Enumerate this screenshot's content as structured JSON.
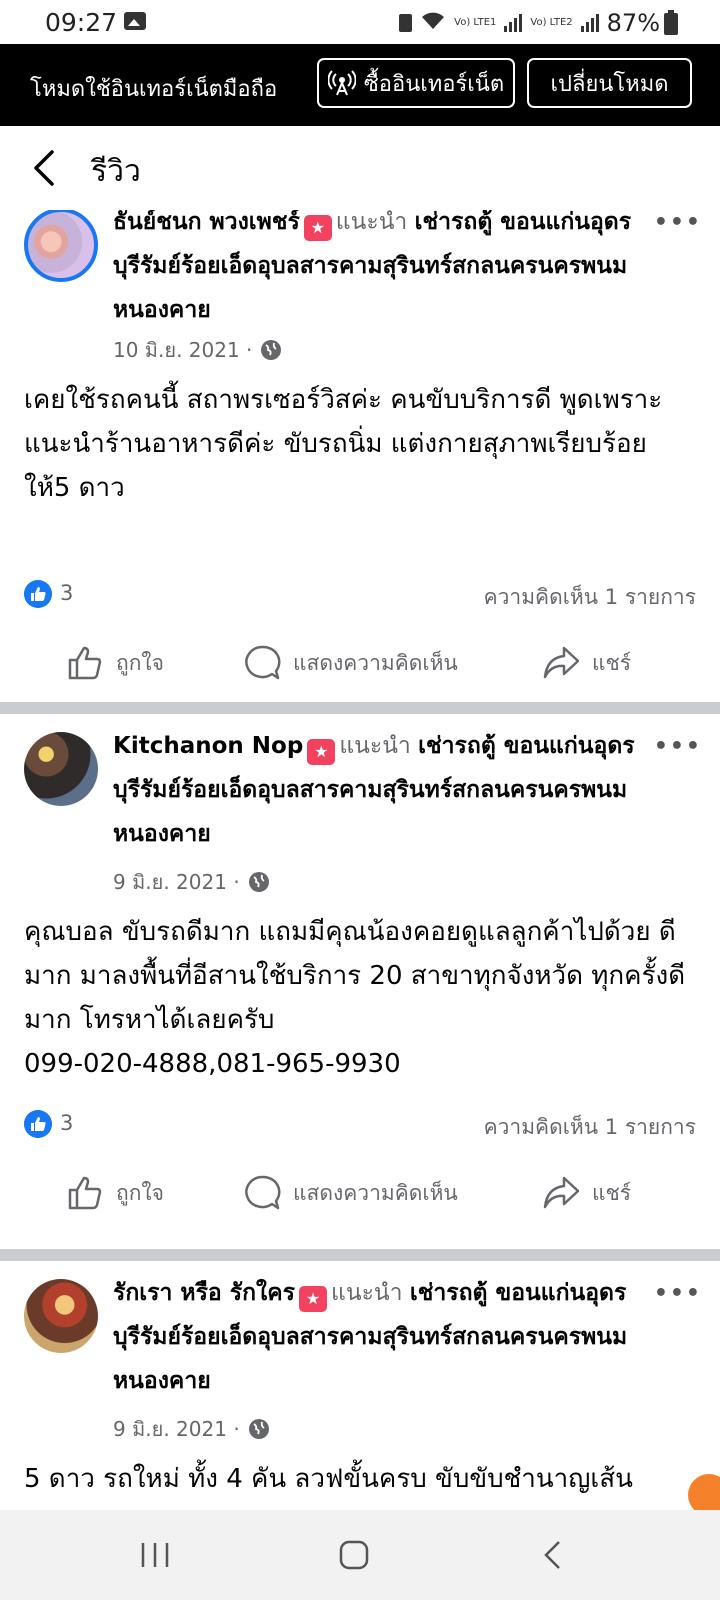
{
  "status_bar": {
    "time": "09:27",
    "battery": "87%",
    "lte1": "Vo) LTE1",
    "lte2": "Vo) LTE2"
  },
  "banner": {
    "text": "โหมดใช้อินเทอร์เน็ตมือถือ",
    "buy_label": "ซื้ออินเทอร์เน็ต",
    "switch_label": "เปลี่ยนโหมด"
  },
  "header": {
    "title": "รีวิว"
  },
  "posts": [
    {
      "author": "ธันย์ชนก พวงเพชร์",
      "recommends": "แนะนำ",
      "page_name": "เช่ารถตู้ ขอนแก่นอุดรบุรีรัมย์ร้อยเอ็ดอุบลสารคามสุรินทร์สกลนครนครพนมหนองคาย",
      "date": "10 มิ.ย. 2021 ·",
      "body": "เคยใช้รถคนนี้ สถาพรเซอร์วิสค่ะ คนขับบริการดี พูดเพราะ\nแนะนำร้านอาหารดีค่ะ ขับรถนิ่ม แต่งกายสุภาพเรียบร้อย ให้5 ดาว",
      "likes": "3",
      "comments": "ความคิดเห็น 1 รายการ"
    },
    {
      "author": "Kitchanon Nop",
      "recommends": "แนะนำ",
      "page_name": "เช่ารถตู้ ขอนแก่นอุดรบุรีรัมย์ร้อยเอ็ดอุบลสารคามสุรินทร์สกลนครนครพนมหนองคาย",
      "date": "9 มิ.ย. 2021 ·",
      "body": "คุณบอล ขับรถดีมาก แถมมีคุณน้องคอยดูแลลูกค้าไปด้วย ดีมาก มาลงพื้นที่อีสานใช้บริการ 20 สาขาทุกจังหวัด ทุกครั้งดีมาก โทรหาได้เลยครับ\n099-020-4888,081-965-9930",
      "likes": "3",
      "comments": "ความคิดเห็น 1 รายการ"
    },
    {
      "author": "รักเรา หรือ รักใคร",
      "recommends": "แนะนำ",
      "page_name": "เช่ารถตู้ ขอนแก่นอุดรบุรีรัมย์ร้อยเอ็ดอุบลสารคามสุรินทร์สกลนครนครพนมหนองคาย",
      "date": "9 มิ.ย. 2021 ·",
      "body": "5 ดาว รถใหม่ ทั้ง 4 คัน ลวฟขั้นครบ ขับขับชำนาญเส้น"
    }
  ],
  "actions": {
    "like": "ถูกใจ",
    "comment": "แสดงความคิดเห็น",
    "share": "แชร์"
  },
  "colors": {
    "brand_blue": "#1877f2",
    "badge_red": "#f3425f",
    "muted_text": "#65676b",
    "separator": "#c9ccd1"
  },
  "icons": [
    "gallery-icon",
    "wifi-icon",
    "signal-icon",
    "battery-icon",
    "antenna-icon",
    "back-arrow-icon",
    "recommend-badge-icon",
    "globe-icon",
    "more-icon",
    "like-reaction-icon",
    "thumbs-up-icon",
    "comment-icon",
    "share-icon",
    "nav-recents-icon",
    "nav-home-icon",
    "nav-back-icon"
  ]
}
